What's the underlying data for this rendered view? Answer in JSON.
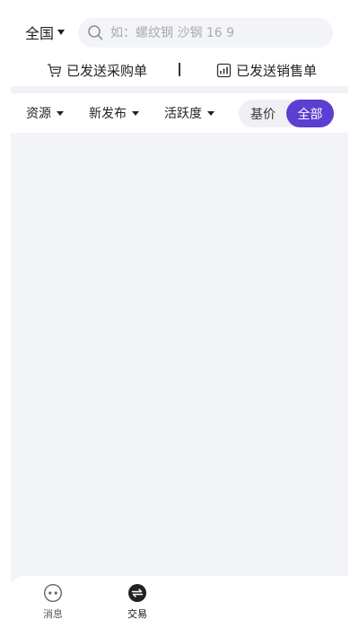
{
  "header": {
    "region_label": "全国",
    "search_placeholder": "如：螺纹钢 沙钢 16 9"
  },
  "orders": {
    "purchase_label": "已发送采购单",
    "sales_label": "已发送销售单"
  },
  "filters": {
    "items": [
      {
        "label": "资源"
      },
      {
        "label": "新发布"
      },
      {
        "label": "活跃度"
      }
    ],
    "toggle": {
      "option_basis": "基价",
      "option_all": "全部",
      "selected": "全部",
      "active_color": "#5a3fd0"
    }
  },
  "bottom_nav": {
    "items": [
      {
        "label": "消息",
        "icon": "message-bubble-icon"
      },
      {
        "label": "交易",
        "icon": "trade-exchange-icon"
      }
    ]
  }
}
